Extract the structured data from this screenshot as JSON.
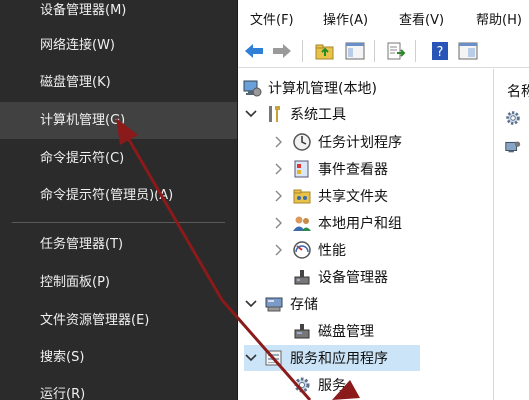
{
  "winx_menu": {
    "items": [
      {
        "label": "设备管理器(M)"
      },
      {
        "label": "网络连接(W)"
      },
      {
        "label": "磁盘管理(K)"
      },
      {
        "label": "计算机管理(G)"
      },
      {
        "label": "命令提示符(C)"
      },
      {
        "label": "命令提示符(管理员)(A)"
      },
      {
        "label": "任务管理器(T)"
      },
      {
        "label": "控制面板(P)"
      },
      {
        "label": "文件资源管理器(E)"
      },
      {
        "label": "搜索(S)"
      },
      {
        "label": "运行(R)"
      }
    ],
    "highlighted": "计算机管理(G)"
  },
  "mmc": {
    "menus": [
      {
        "label": "文件(F)"
      },
      {
        "label": "操作(A)"
      },
      {
        "label": "查看(V)"
      },
      {
        "label": "帮助(H)"
      }
    ],
    "toolbar_icons": [
      "back-arrow-icon",
      "forward-arrow-icon",
      "up-folder-icon",
      "show-hide-tree-icon",
      "export-list-icon",
      "help-icon",
      "properties-icon"
    ],
    "tree": {
      "root": "计算机管理(本地)",
      "system_tools": "系统工具",
      "task_scheduler": "任务计划程序",
      "event_viewer": "事件查看器",
      "shared_folders": "共享文件夹",
      "local_users": "本地用户和组",
      "performance": "性能",
      "device_manager": "设备管理器",
      "storage": "存储",
      "disk_management": "磁盘管理",
      "services_apps": "服务和应用程序",
      "services": "服务"
    },
    "right_pane_header": "名称"
  },
  "colors": {
    "menu_bg": "#2b2b2b",
    "menu_highlight": "#414141",
    "arrow": "#8b1a1a",
    "selection": "#cce4f7"
  }
}
